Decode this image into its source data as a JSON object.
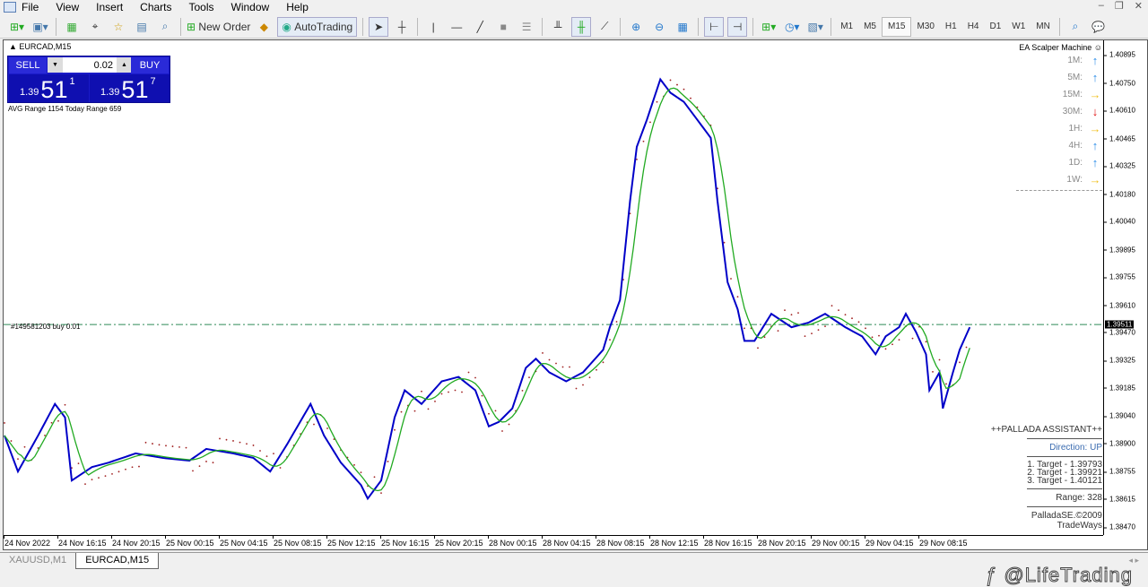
{
  "menu": [
    "File",
    "View",
    "Insert",
    "Charts",
    "Tools",
    "Window",
    "Help"
  ],
  "toolbar": {
    "new_order": "New Order",
    "autotrading": "AutoTrading",
    "timeframes": [
      "M1",
      "M5",
      "M15",
      "M30",
      "H1",
      "H4",
      "D1",
      "W1",
      "MN"
    ],
    "active_timeframe": "M15"
  },
  "chart": {
    "symbol": "EURCAD,M15",
    "trade_panel": {
      "sell": "SELL",
      "buy": "BUY",
      "lot": "0.02",
      "bid_small": "1.39",
      "bid_big": "51",
      "bid_sup": "1",
      "ask_small": "1.39",
      "ask_big": "51",
      "ask_sup": "7"
    },
    "ranges": "AVG Range 1154   Today Range 659",
    "order_line_label": "#149581203 buy 0.01",
    "ea": {
      "title": "EA Scalper Machine",
      "rows": [
        {
          "tf": "1M:",
          "dir": "up"
        },
        {
          "tf": "5M:",
          "dir": "up"
        },
        {
          "tf": "15M:",
          "dir": "right"
        },
        {
          "tf": "30M:",
          "dir": "down"
        },
        {
          "tf": "1H:",
          "dir": "right"
        },
        {
          "tf": "4H:",
          "dir": "up"
        },
        {
          "tf": "1D:",
          "dir": "up"
        },
        {
          "tf": "1W:",
          "dir": "right"
        }
      ]
    },
    "palladas": {
      "title": "++PALLADA ASSISTANT++",
      "direction": "Direction: UP",
      "t1": "1. Target - 1.39793",
      "t2": "2. Target - 1.39921",
      "t3": "3. Target - 1.40121",
      "range": "Range: 328",
      "copyright": "PalladaSE.©2009 TradeWays"
    },
    "watermark": "@LifeTrading"
  },
  "chart_data": {
    "type": "line",
    "title": "EURCAD,M15",
    "current_price": "1.39511",
    "order_price": 1.39511,
    "ylim": [
      1.3843,
      1.4097
    ],
    "y_ticks": [
      "1.40895",
      "1.40750",
      "1.40610",
      "1.40465",
      "1.40325",
      "1.40180",
      "1.40040",
      "1.39895",
      "1.39755",
      "1.39610",
      "1.39470",
      "1.39325",
      "1.39185",
      "1.39040",
      "1.38900",
      "1.38755",
      "1.38615",
      "1.38470"
    ],
    "x_ticks": [
      "24 Nov 2022",
      "24 Nov 16:15",
      "24 Nov 20:15",
      "25 Nov 00:15",
      "25 Nov 04:15",
      "25 Nov 08:15",
      "25 Nov 12:15",
      "25 Nov 16:15",
      "25 Nov 20:15",
      "28 Nov 00:15",
      "28 Nov 04:15",
      "28 Nov 08:15",
      "28 Nov 12:15",
      "28 Nov 16:15",
      "28 Nov 20:15",
      "29 Nov 00:15",
      "29 Nov 04:15",
      "29 Nov 08:15"
    ],
    "bars_per_tick": 16,
    "series": [
      {
        "name": "price",
        "points": [
          [
            0,
            1.38941
          ],
          [
            4,
            1.38756
          ],
          [
            10,
            1.38941
          ],
          [
            15,
            1.39103
          ],
          [
            18,
            1.39034
          ],
          [
            20,
            1.3871
          ],
          [
            26,
            1.38779
          ],
          [
            31,
            1.38802
          ],
          [
            39,
            1.38849
          ],
          [
            47,
            1.38826
          ],
          [
            55,
            1.38812
          ],
          [
            60,
            1.38872
          ],
          [
            68,
            1.38849
          ],
          [
            74,
            1.38826
          ],
          [
            79,
            1.38756
          ],
          [
            84,
            1.38895
          ],
          [
            91,
            1.39103
          ],
          [
            95,
            1.38941
          ],
          [
            100,
            1.38802
          ],
          [
            106,
            1.38687
          ],
          [
            108,
            1.38617
          ],
          [
            112,
            1.3871
          ],
          [
            116,
            1.39034
          ],
          [
            119,
            1.39173
          ],
          [
            124,
            1.39103
          ],
          [
            130,
            1.39219
          ],
          [
            135,
            1.39242
          ],
          [
            140,
            1.39173
          ],
          [
            144,
            1.38988
          ],
          [
            147,
            1.39011
          ],
          [
            151,
            1.3908
          ],
          [
            155,
            1.39288
          ],
          [
            158,
            1.39335
          ],
          [
            162,
            1.39265
          ],
          [
            167,
            1.39219
          ],
          [
            172,
            1.39265
          ],
          [
            178,
            1.39381
          ],
          [
            180,
            1.39497
          ],
          [
            183,
            1.39636
          ],
          [
            186,
            1.40145
          ],
          [
            188,
            1.40423
          ],
          [
            191,
            1.40562
          ],
          [
            195,
            1.4077
          ],
          [
            198,
            1.40701
          ],
          [
            202,
            1.40654
          ],
          [
            206,
            1.40562
          ],
          [
            210,
            1.40469
          ],
          [
            212,
            1.40145
          ],
          [
            215,
            1.39728
          ],
          [
            218,
            1.39589
          ],
          [
            220,
            1.39427
          ],
          [
            223,
            1.39427
          ],
          [
            228,
            1.39566
          ],
          [
            234,
            1.39497
          ],
          [
            239,
            1.3952
          ],
          [
            244,
            1.39566
          ],
          [
            250,
            1.39497
          ],
          [
            255,
            1.3945
          ],
          [
            259,
            1.39358
          ],
          [
            262,
            1.3945
          ],
          [
            266,
            1.39497
          ],
          [
            268,
            1.39566
          ],
          [
            271,
            1.39473
          ],
          [
            274,
            1.39358
          ],
          [
            275,
            1.39173
          ],
          [
            278,
            1.39265
          ],
          [
            279,
            1.3908
          ],
          [
            282,
            1.39265
          ],
          [
            284,
            1.39381
          ],
          [
            287,
            1.39497
          ]
        ]
      }
    ]
  },
  "tabs": [
    "XAUUSD,M1",
    "EURCAD,M15"
  ],
  "colors": {
    "price": "#0000c8",
    "ma": "#22aa22",
    "sar": "#a02020",
    "up": "#2a8ce8",
    "down": "#e01010",
    "right": "#f0c020"
  }
}
